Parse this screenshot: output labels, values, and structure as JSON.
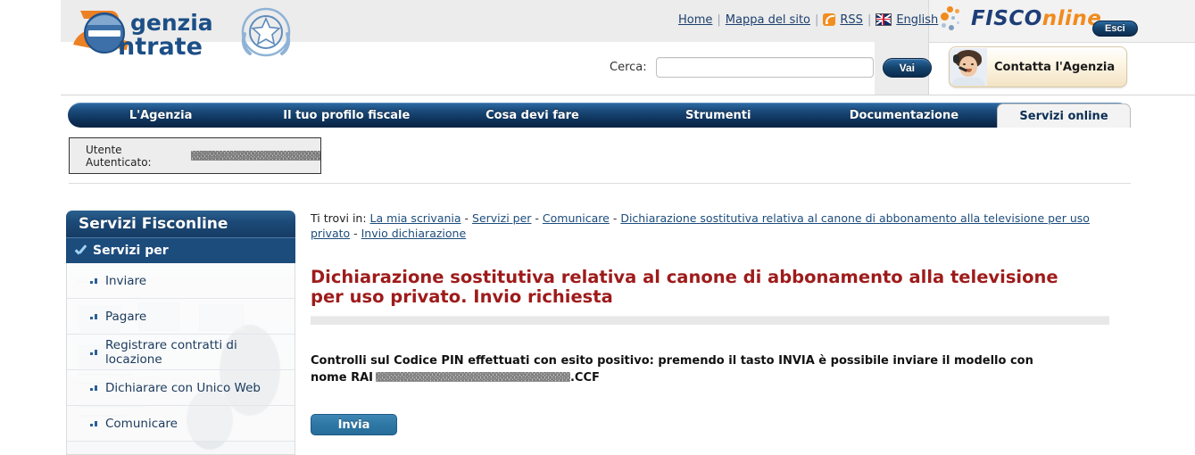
{
  "header": {
    "logo_alt": "Agenzia Entrate",
    "logo_word_1": "genzia",
    "logo_word_2": "ntrate",
    "top_links": [
      {
        "label": "Home",
        "icon": null
      },
      {
        "label": "Mappa del sito",
        "icon": null
      },
      {
        "label": "RSS",
        "icon": "rss-icon"
      },
      {
        "label": "English",
        "icon": "uk-flag-icon"
      }
    ],
    "search": {
      "label": "Cerca:",
      "value": "",
      "placeholder": "",
      "button": "Vai"
    },
    "fisconline": {
      "brand_dark": "FISCO",
      "brand_orange": "nline",
      "logout_button": "Esci"
    },
    "contact": {
      "label": "Contatta l'Agenzia"
    }
  },
  "nav": {
    "items": [
      {
        "label": "L'Agenzia",
        "active": false
      },
      {
        "label": "Il tuo profilo fiscale",
        "active": false
      },
      {
        "label": "Cosa devi fare",
        "active": false
      },
      {
        "label": "Strumenti",
        "active": false
      },
      {
        "label": "Documentazione",
        "active": false
      },
      {
        "label": "Servizi online",
        "active": true
      }
    ]
  },
  "auth": {
    "label": "Utente Autenticato:",
    "user": ""
  },
  "sidebar": {
    "title": "Servizi Fisconline",
    "active_section": "Servizi per",
    "items": [
      {
        "label": "Inviare"
      },
      {
        "label": "Pagare"
      },
      {
        "label": "Registrare contratti di locazione"
      },
      {
        "label": "Dichiarare con Unico Web"
      },
      {
        "label": "Comunicare"
      }
    ]
  },
  "main": {
    "breadcrumb_prefix": "Ti trovi in:",
    "breadcrumb": [
      {
        "label": "La mia scrivania"
      },
      {
        "label": "Servizi per"
      },
      {
        "label": "Comunicare"
      },
      {
        "label": "Dichiarazione sostitutiva relativa al canone di abbonamento alla televisione per uso privato"
      },
      {
        "label": "Invio dichiarazione"
      }
    ],
    "title": "Dichiarazione sostitutiva relativa al canone di abbonamento alla televisione per uso privato. Invio richiesta",
    "message_before": "Controlli sul Codice PIN effettuati con esito positivo: premendo il tasto INVIA è possibile inviare il modello con nome RAI",
    "message_after": ".CCF",
    "submit_button": "Invia"
  },
  "colors": {
    "nav_blue": "#0d2f55",
    "title_red": "#9e1b1b",
    "sidebar_blue": "#1c4c7c",
    "accent_orange": "#f08b1d",
    "button_blue": "#2e77a5"
  }
}
